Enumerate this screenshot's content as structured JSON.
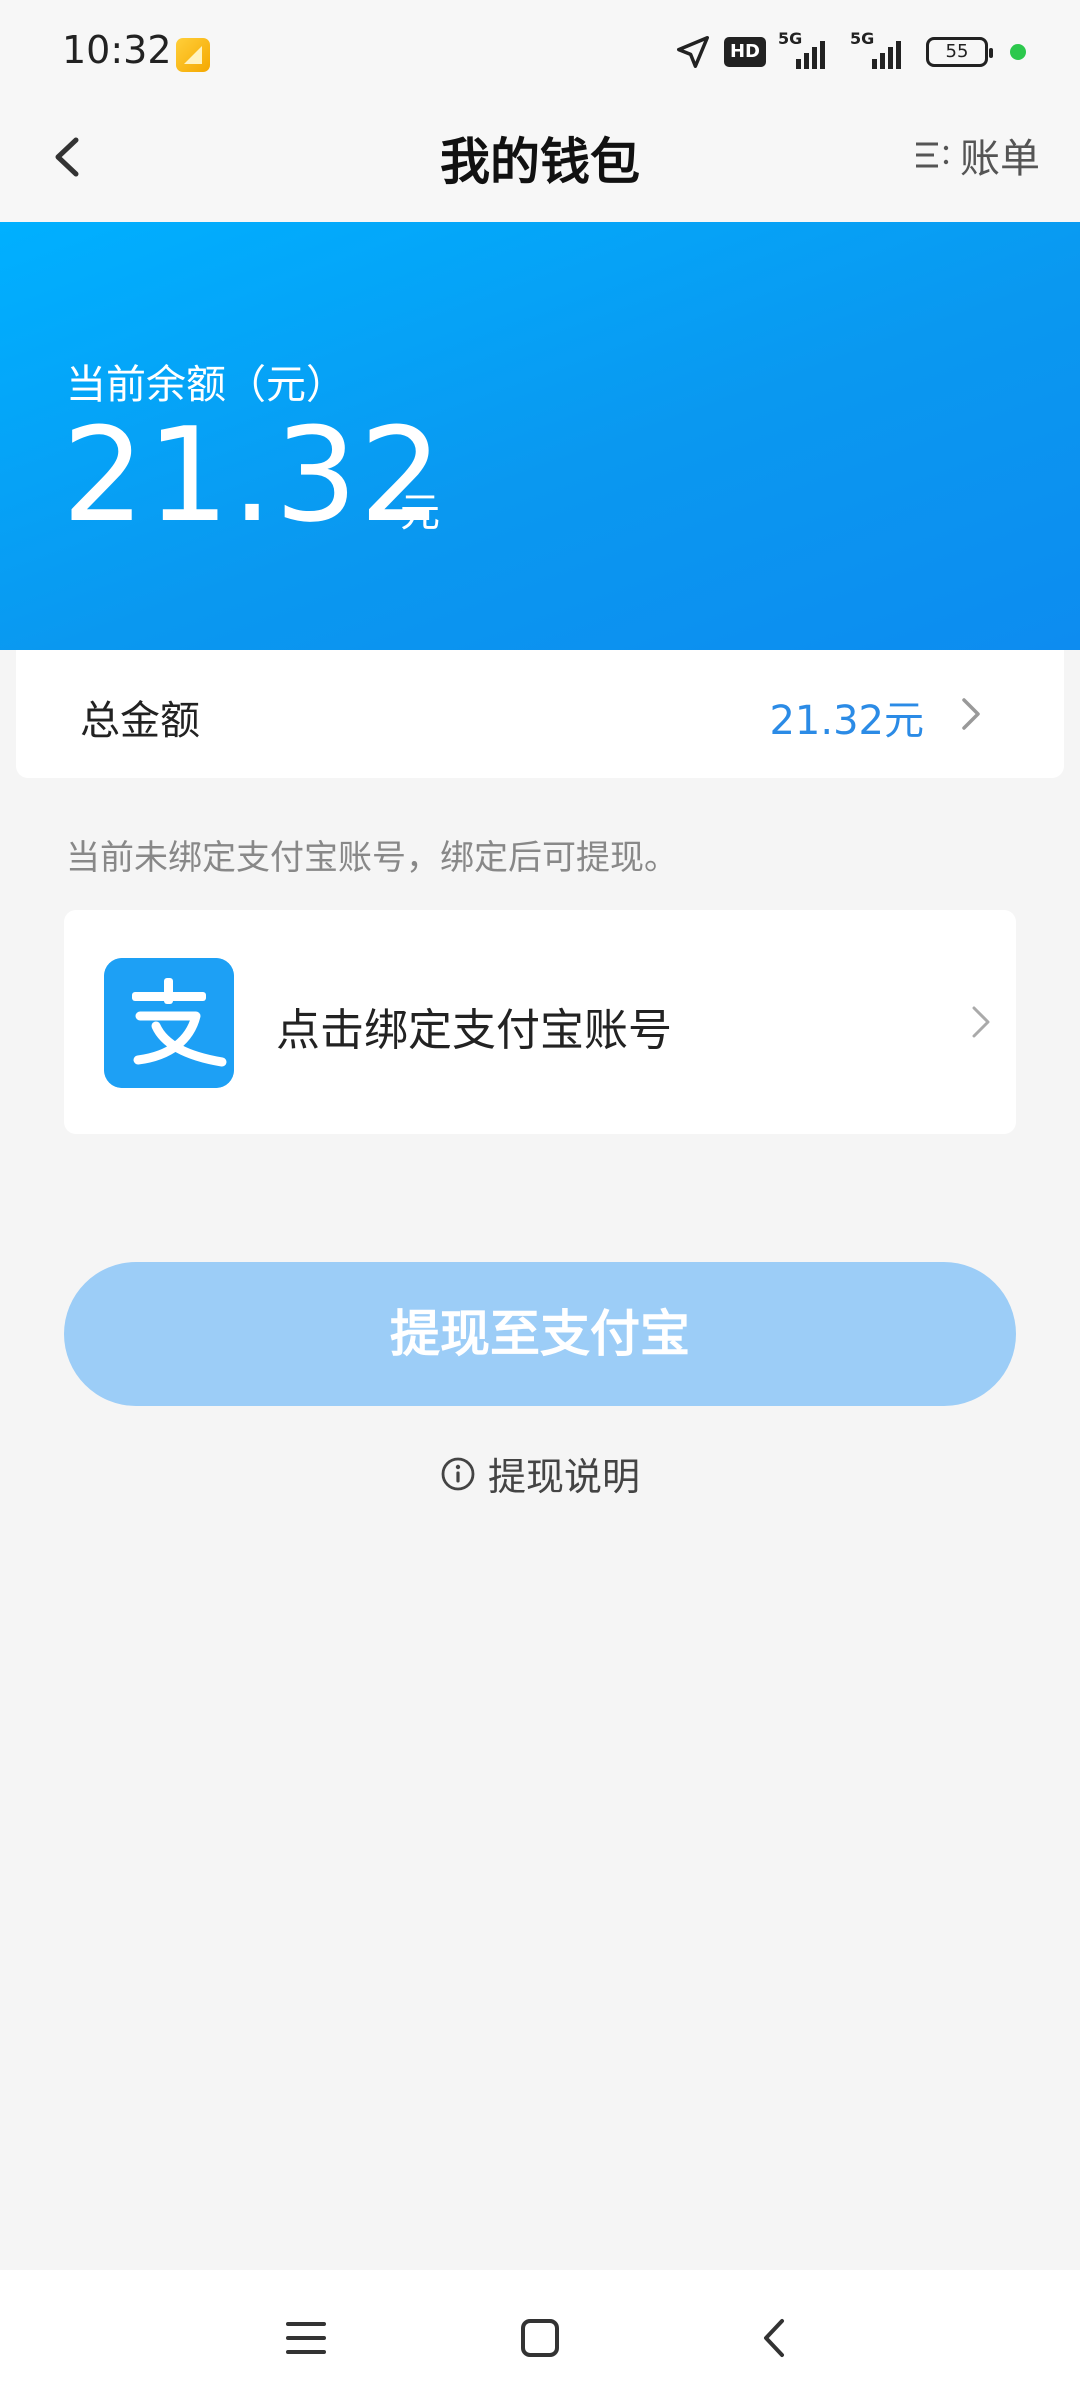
{
  "status_bar": {
    "time": "10:32",
    "hd_label": "HD",
    "network_1": "5G",
    "network_2": "5G",
    "battery": "55"
  },
  "header": {
    "title": "我的钱包",
    "bill_label": "账单"
  },
  "balance": {
    "label": "当前余额（元）",
    "value": "21.32",
    "unit": "元"
  },
  "total": {
    "label": "总金额",
    "value": "21.32元"
  },
  "hint": "当前未绑定支付宝账号，绑定后可提现。",
  "bind_card": {
    "label": "点击绑定支付宝账号"
  },
  "withdraw_button": "提现至支付宝",
  "withdraw_info": "提现说明",
  "colors": {
    "accent": "#0d9af0",
    "button": "#9ccdf7",
    "total_value": "#2b8be6"
  }
}
